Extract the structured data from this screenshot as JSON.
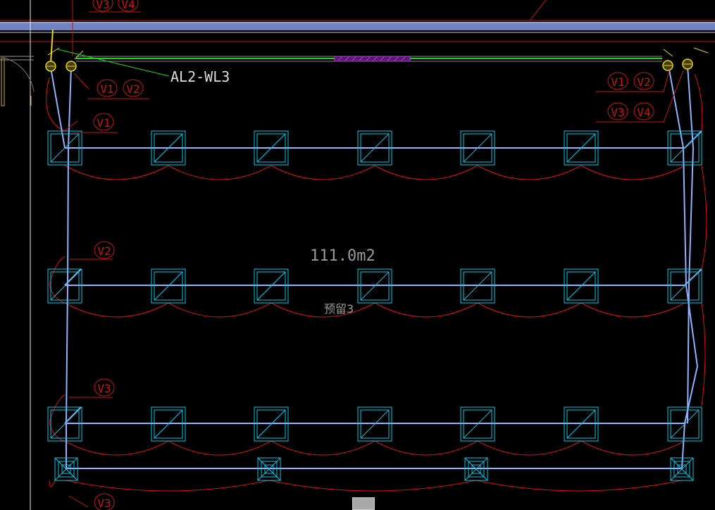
{
  "drawing": {
    "circuit_label": "AL2-WL3",
    "area_label": "111.0m2",
    "reserved_label": "预留3",
    "tags": {
      "v1": "V1",
      "v2": "V2",
      "v3": "V3",
      "v4": "V4"
    }
  },
  "colors": {
    "background": "#000000",
    "lamp_outline": "#00c8e6",
    "wiring": "#8fb3ff",
    "arc": "#e01010",
    "leader": "#c81414",
    "circuit_leader": "#1ed21e",
    "switch": "#e6d21e",
    "wall_band": "#6f83c0",
    "label_text": "#dddddd",
    "area_text": "#9a9a9a"
  }
}
